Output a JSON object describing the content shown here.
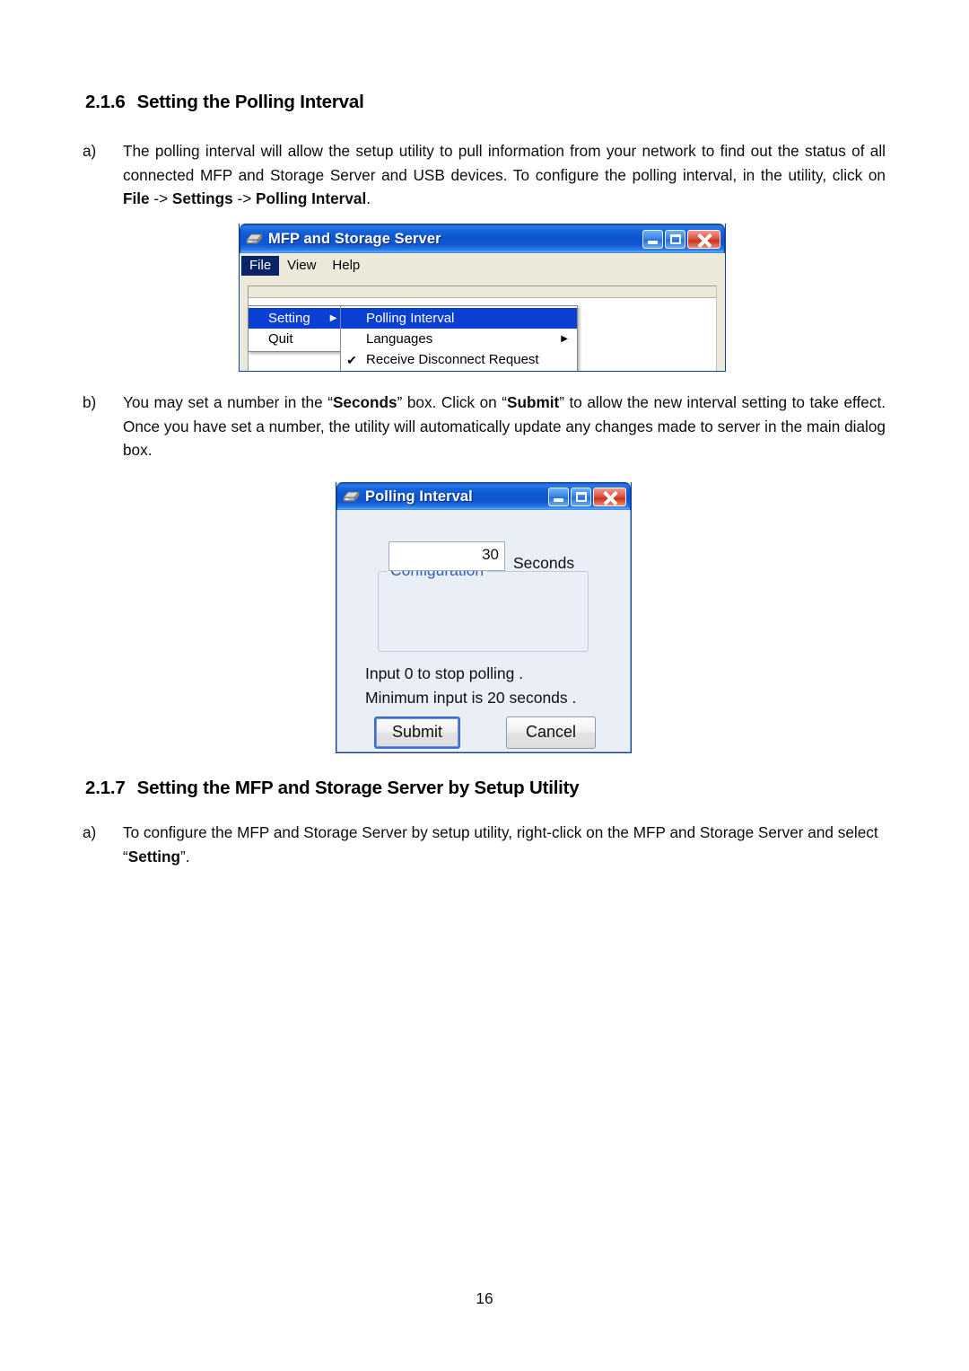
{
  "document": {
    "page_number": "16",
    "sections": [
      {
        "number": "2.1.6",
        "title": "Setting the Polling Interval"
      },
      {
        "number": "2.1.7",
        "title": "Setting the MFP and Storage Server by Setup Utility"
      }
    ],
    "paragraphs": {
      "a1_marker": "a)",
      "a1_part1": "The polling interval will allow the setup utility to pull information from your network to find out the status of all connected MFP and Storage Server and USB devices. To configure the polling interval, in the utility, click on ",
      "a1_b_file": "File",
      "a1_sep1": " -> ",
      "a1_b_settings": "Settings",
      "a1_sep2": " -> ",
      "a1_b_polling": "Polling Interval",
      "a1_end": ".",
      "b1_marker": "b)",
      "b1_part1": "You may set a number in the “",
      "b1_b_seconds": "Seconds",
      "b1_part2": "” box. Click on “",
      "b1_b_submit": "Submit",
      "b1_part3": "” to allow the new interval setting to take effect. Once you have set a number, the utility will automatically update any changes made to server in the main dialog box.",
      "a2_marker": "a)",
      "a2_part1": "To configure the MFP and Storage Server by setup utility, right-click on the MFP and Storage Server and select “",
      "a2_b_setting": "Setting",
      "a2_part2": "”."
    }
  },
  "mfp_window": {
    "title": "MFP and Storage Server",
    "icon": "server-device-icon",
    "titlebar_buttons": {
      "minimize": "minimize-icon",
      "maximize": "maximize-icon",
      "close": "close-icon"
    },
    "menubar": [
      {
        "label": "File",
        "open": true
      },
      {
        "label": "View",
        "open": false
      },
      {
        "label": "Help",
        "open": false
      }
    ],
    "file_menu": [
      {
        "label": "Setting",
        "has_submenu": true,
        "selected": true,
        "arrow": "▶"
      },
      {
        "label": "Quit",
        "has_submenu": false,
        "selected": false,
        "arrow": ""
      }
    ],
    "setting_submenu": [
      {
        "label": "Polling Interval",
        "selected": true,
        "checked": false,
        "has_submenu": false,
        "check": "",
        "arrow": ""
      },
      {
        "label": "Languages",
        "selected": false,
        "checked": false,
        "has_submenu": true,
        "check": "",
        "arrow": "▶"
      },
      {
        "label": "Receive Disconnect Request",
        "selected": false,
        "checked": true,
        "has_submenu": false,
        "check": "✔",
        "arrow": ""
      }
    ]
  },
  "polling_dialog": {
    "title": "Polling Interval",
    "icon": "server-device-icon",
    "titlebar_buttons": {
      "minimize": "minimize-icon",
      "maximize": "maximize-icon",
      "close": "close-icon"
    },
    "groupbox_title": "Configuration",
    "seconds_value": "30",
    "seconds_label": "Seconds",
    "info_line_1": "Input 0 to stop polling .",
    "info_line_2": "Minimum input is 20 seconds .",
    "submit_label": "Submit",
    "cancel_label": "Cancel"
  },
  "colors": {
    "titlebar_blue": "#1664dc",
    "menu_highlight": "#0a3fd4",
    "menubar_open": "#0a246a",
    "window_face": "#ece9d8",
    "dialog_face": "#eaeef7",
    "groupbox_label": "#2f5fbd",
    "close_red": "#c9341d"
  }
}
